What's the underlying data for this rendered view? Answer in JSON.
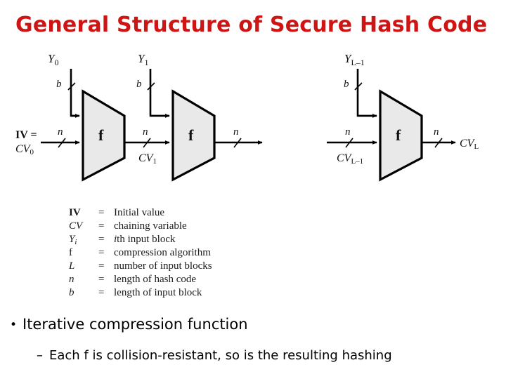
{
  "slide": {
    "title": "General Structure of Secure Hash Code",
    "title_color": "#cf1414",
    "background": "#ffffff"
  },
  "diagram": {
    "block_fill": "#e9e9e9",
    "stroke": "#000000",
    "stages": [
      {
        "id": "stage-0",
        "function_label": "f",
        "message_block_label": "Y",
        "message_block_sub": "0",
        "message_width_label": "b",
        "chain_in_label": "IV =",
        "chain_in_label2": "CV",
        "chain_in_sub": "0",
        "chain_in_width_label": "n",
        "chain_out_width_label": "n",
        "chain_out_label": "CV",
        "chain_out_sub": "1"
      },
      {
        "id": "stage-1",
        "function_label": "f",
        "message_block_label": "Y",
        "message_block_sub": "1",
        "message_width_label": "b",
        "chain_in_width_label": "n",
        "chain_out_width_label": "n"
      },
      {
        "id": "stage-last",
        "function_label": "f",
        "message_block_label": "Y",
        "message_block_sub": "L–1",
        "message_width_label": "b",
        "chain_in_label": "CV",
        "chain_in_sub": "L–1",
        "chain_in_width_label": "n",
        "chain_out_width_label": "n",
        "chain_out_label": "CV",
        "chain_out_sub": "L"
      }
    ]
  },
  "legend": {
    "rows": [
      {
        "symbol": "IV",
        "symbol_style": "upright-bold",
        "equals": "=",
        "description": "Initial value"
      },
      {
        "symbol": "CV",
        "symbol_style": "italic",
        "equals": "=",
        "description": "chaining variable"
      },
      {
        "symbol": "Y",
        "symbol_sub": "i",
        "symbol_style": "italic",
        "equals": "=",
        "description_pre": "i",
        "description": "th input block"
      },
      {
        "symbol": "f",
        "symbol_style": "upright",
        "equals": "=",
        "description": "compression algorithm"
      },
      {
        "symbol": "L",
        "symbol_style": "italic",
        "equals": "=",
        "description": "number of input blocks"
      },
      {
        "symbol": "n",
        "symbol_style": "italic",
        "equals": "=",
        "description": "length of hash code"
      },
      {
        "symbol": "b",
        "symbol_style": "italic",
        "equals": "=",
        "description": "length of input block"
      }
    ]
  },
  "bullets": {
    "level1_marker": "•",
    "level1_text": "Iterative compression function",
    "level2_marker": "–",
    "level2_text": "Each f is collision-resistant, so is the resulting hashing"
  }
}
